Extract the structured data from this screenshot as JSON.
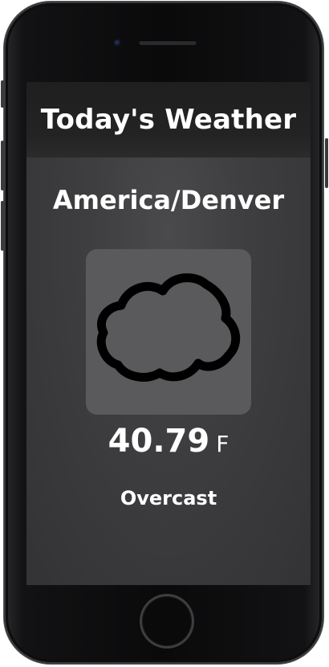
{
  "app": {
    "header_title": "Today's Weather"
  },
  "weather": {
    "location": "America/Denver",
    "icon": "cloud-icon",
    "temperature": "40.79",
    "unit": "F",
    "condition": "Overcast"
  },
  "colors": {
    "header_bg": "#232324",
    "screen_bg": "#3e3e40",
    "icon_tile_bg": "#5a5a5c",
    "text": "#ffffff",
    "cloud_fill": "#5a5a5c",
    "cloud_stroke": "#000000"
  }
}
